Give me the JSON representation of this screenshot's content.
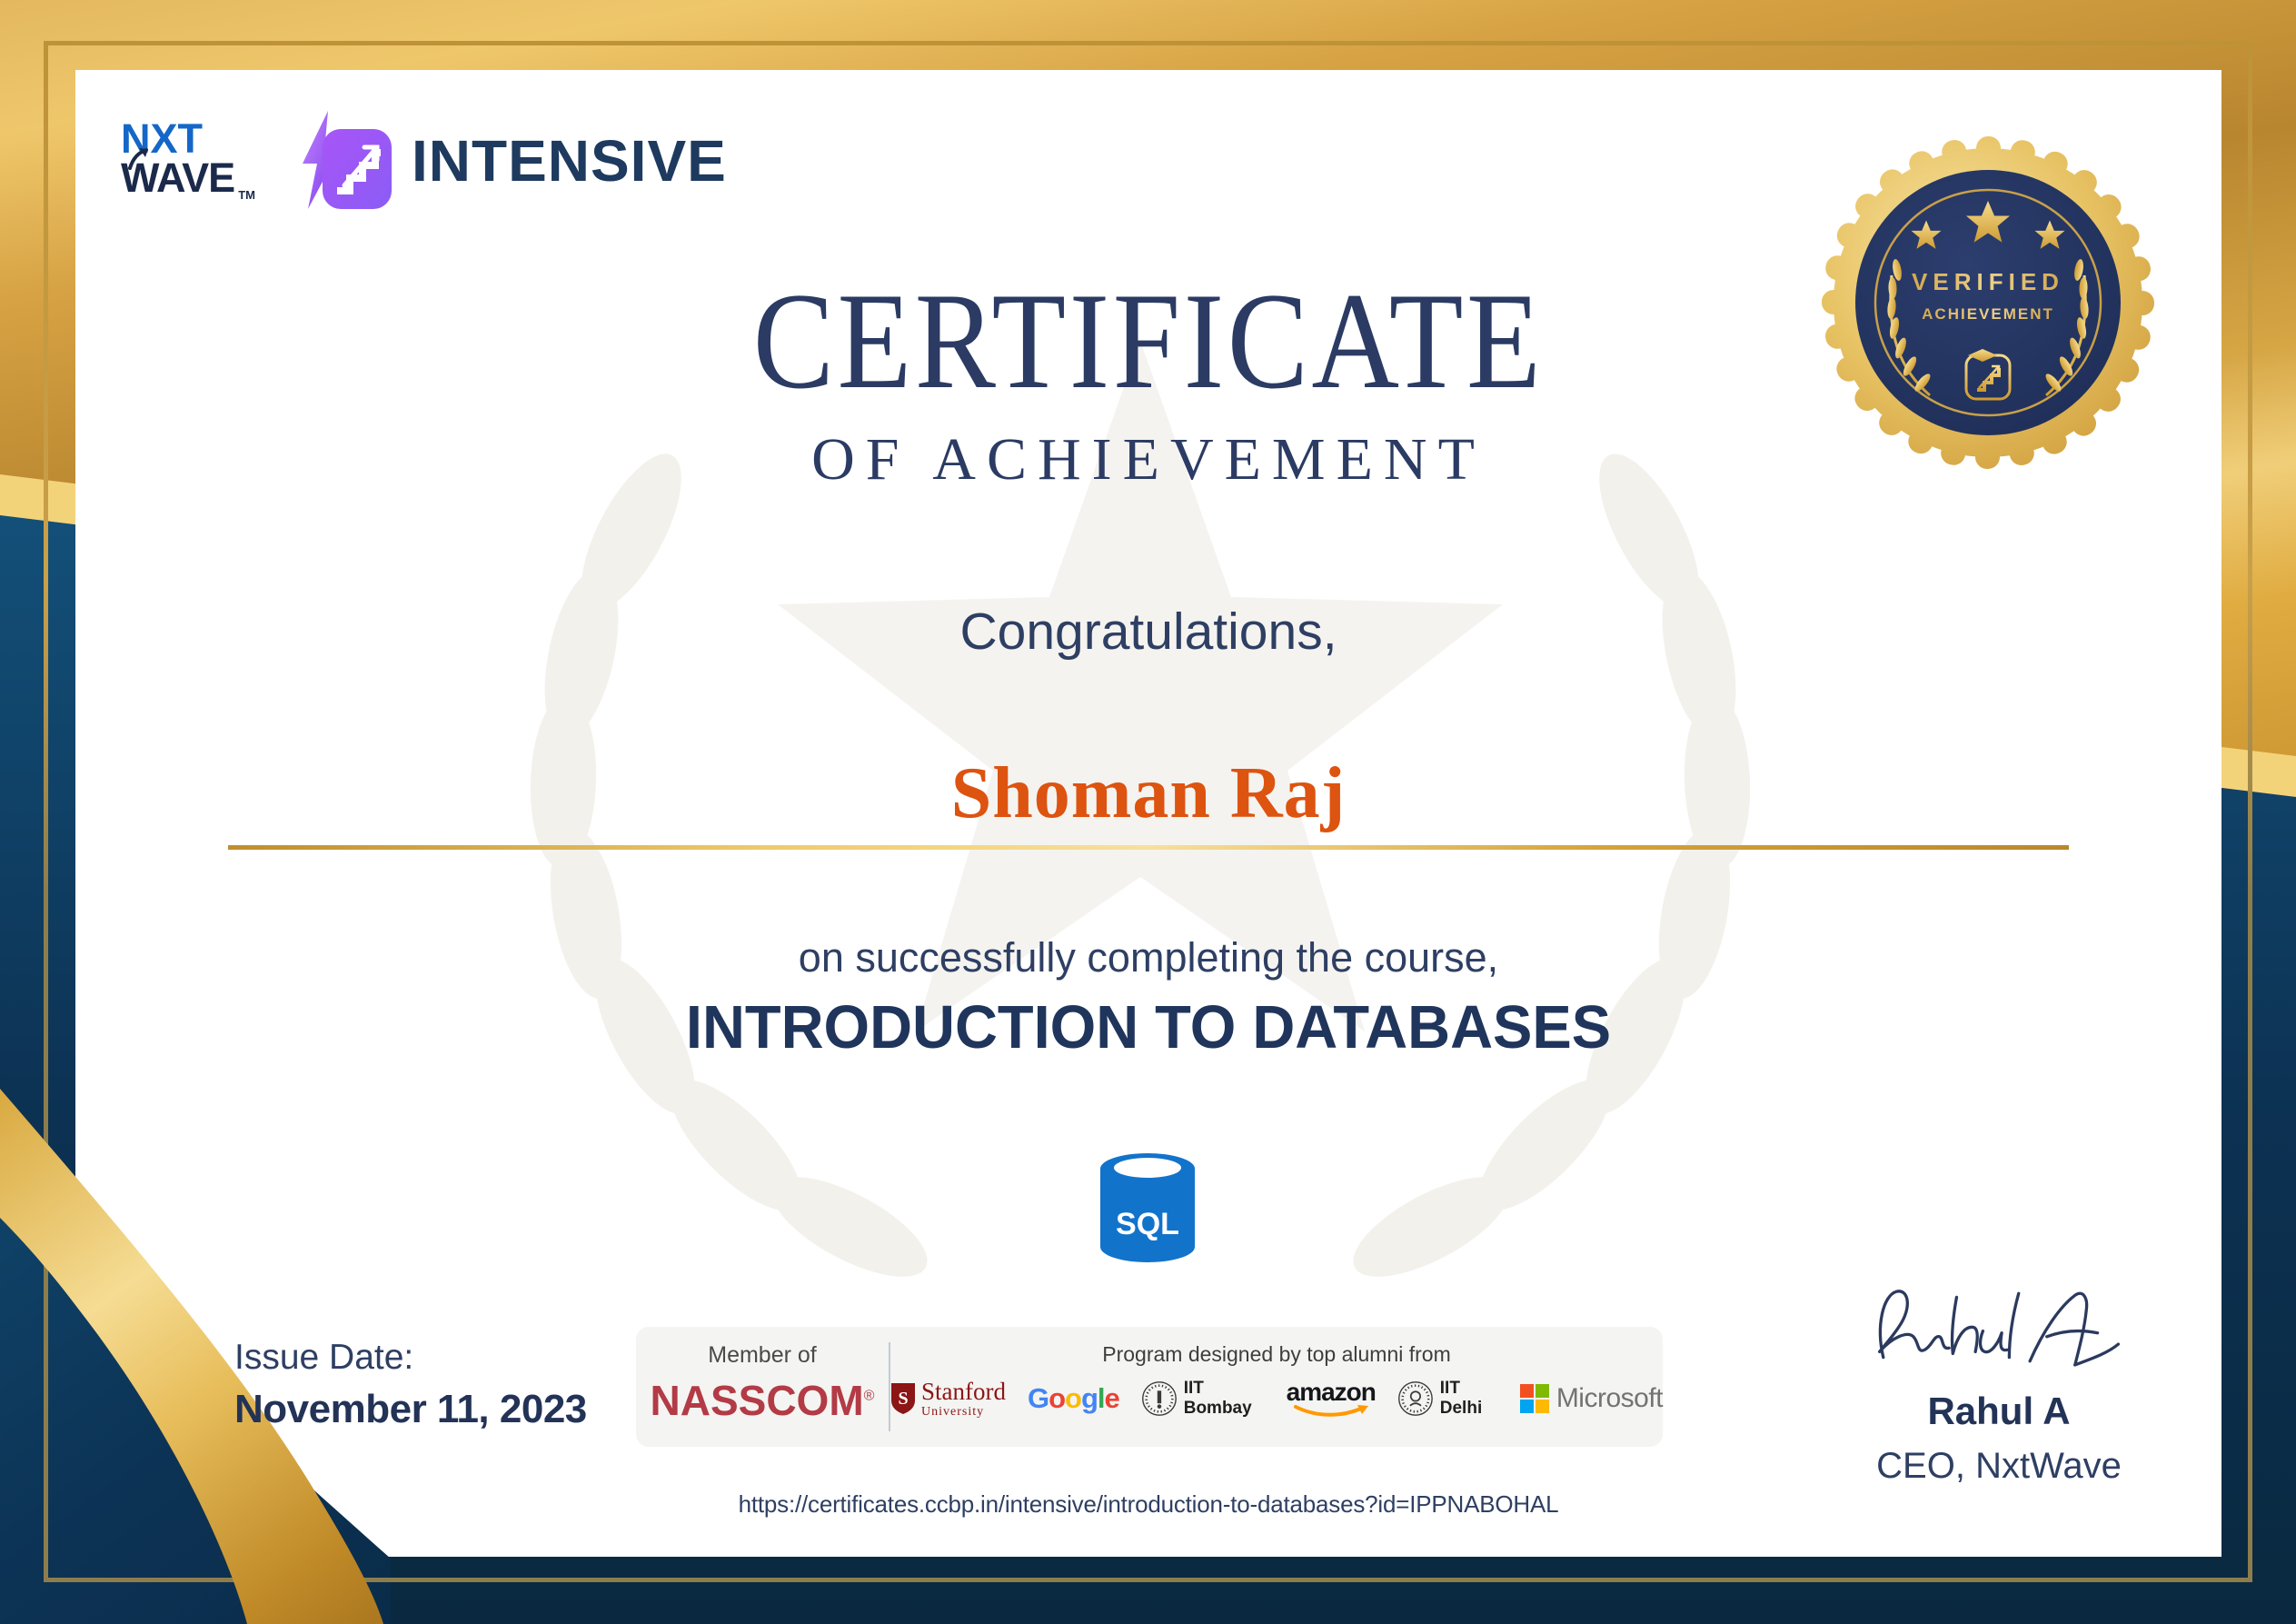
{
  "brand": {
    "nxt": "NXT",
    "wave": "WAVE",
    "tm": "TM",
    "intensive": "INTENSIVE"
  },
  "badge": {
    "stars": "3",
    "line1": "VERIFIED",
    "line2": "ACHIEVEMENT"
  },
  "title": {
    "main": "CERTIFICATE",
    "sub": "OF ACHIEVEMENT"
  },
  "body": {
    "greeting": "Congratulations,",
    "recipient": "Shoman Raj",
    "completion": "on successfully completing the course,",
    "course": "INTRODUCTION TO DATABASES"
  },
  "course_icon": {
    "label": "SQL"
  },
  "issue": {
    "label": "Issue Date:",
    "date": "November 11, 2023"
  },
  "partners": {
    "member_of": "Member of",
    "nasscom": "NASSCOM",
    "registered": "®",
    "heading": "Program designed by top alumni from",
    "stanford": {
      "initial": "S",
      "name": "Stanford",
      "sub": "University"
    },
    "google": [
      "G",
      "o",
      "o",
      "g",
      "l",
      "e"
    ],
    "iit_bombay": "IIT Bombay",
    "amazon": "amazon",
    "iit_delhi": "IIT Delhi",
    "microsoft": "Microsoft"
  },
  "verify_url": "https://certificates.ccbp.in/intensive/introduction-to-databases?id=IPPNABOHAL",
  "signatory": {
    "name": "Rahul A",
    "role": "CEO, NxtWave"
  },
  "colors": {
    "navy_text": "#2E3F63",
    "frame_navy": "#0C3152",
    "gold": "#D9A845",
    "accent_orange": "#DD5310",
    "nasscom_red": "#B23B46",
    "sql_blue": "#1273CB"
  }
}
